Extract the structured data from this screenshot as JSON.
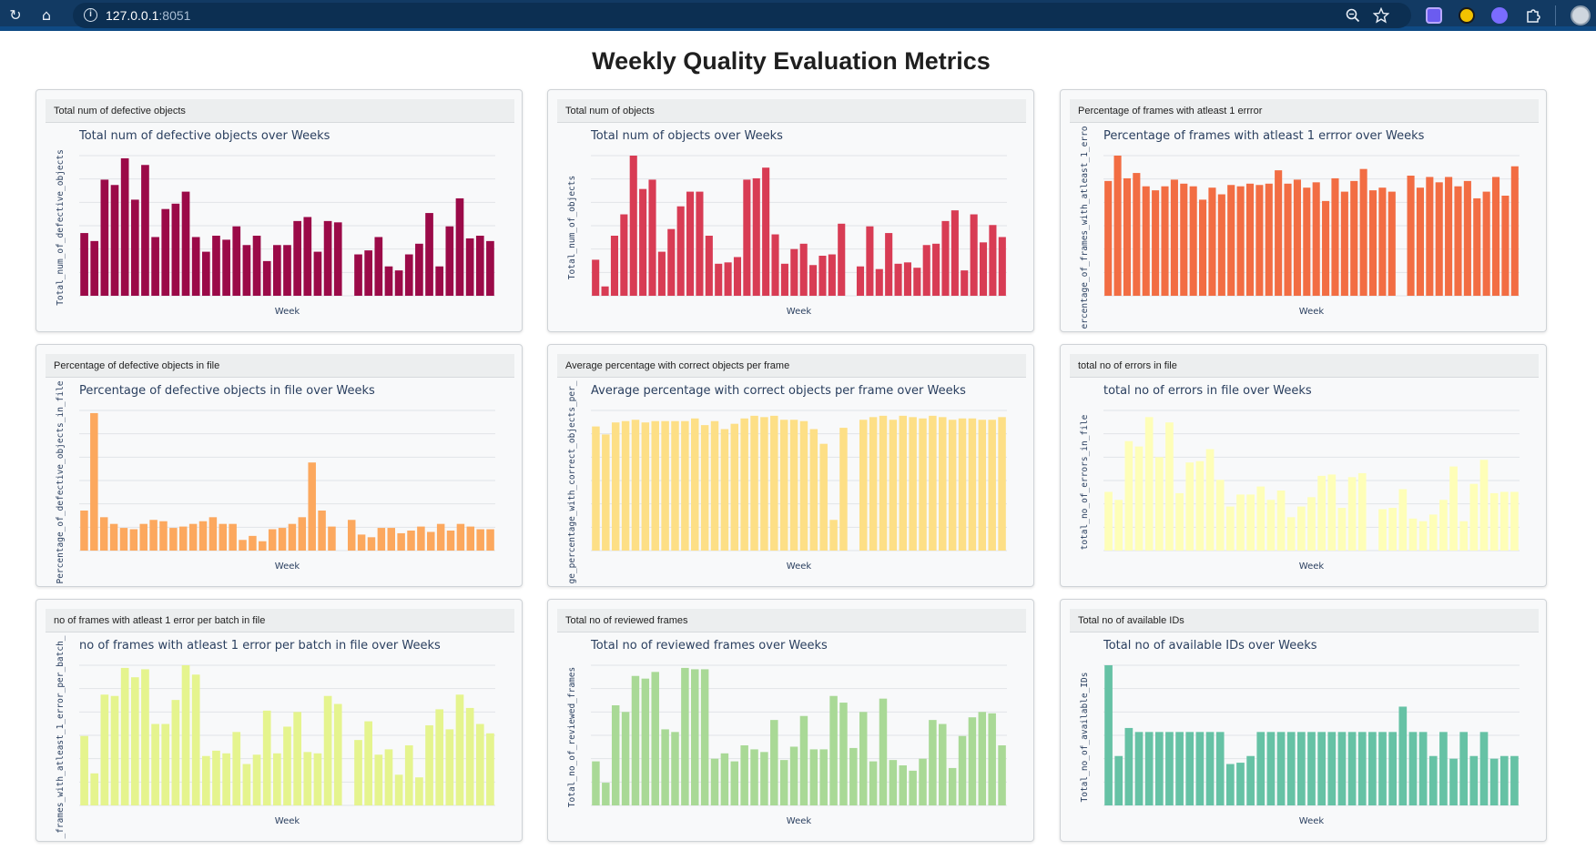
{
  "browser": {
    "url_host": "127.0.0.1",
    "url_port": ":8051",
    "icons": [
      "reload-icon",
      "home-icon",
      "site-info-icon",
      "zoom-icon",
      "bookmark-star-icon",
      "extension-camera-icon",
      "extension-smiley-icon",
      "extension-mask-icon",
      "extensions-puzzle-icon",
      "profile-avatar-icon"
    ]
  },
  "page": {
    "title": "Weekly Quality Evaluation Metrics"
  },
  "charts": [
    {
      "header": "Total num of defective objects",
      "chart_data": {
        "type": "bar",
        "title": "Total num of defective objects over Weeks",
        "xlabel": "Week",
        "ylabel": "Total_num_of_defective_objects",
        "color": "#9b0a48",
        "ylim": [
          0,
          105
        ],
        "grid": true,
        "values": [
          47,
          41,
          87,
          83,
          103,
          72,
          98,
          44,
          65,
          69,
          78,
          44,
          33,
          45,
          42,
          52,
          38,
          45,
          26,
          38,
          38,
          56,
          59,
          33,
          56,
          55,
          null,
          31,
          34,
          44,
          22,
          19,
          31,
          39,
          62,
          22,
          52,
          73,
          43,
          45,
          41
        ]
      }
    },
    {
      "header": "Total num of objects",
      "chart_data": {
        "type": "bar",
        "title": "Total num of objects over Weeks",
        "xlabel": "Week",
        "ylabel": "Total_num_of_objects",
        "color": "#d83c54",
        "ylim": [
          0,
          105
        ],
        "grid": true,
        "values": [
          27,
          7,
          45,
          61,
          105,
          80,
          87,
          33,
          50,
          67,
          78,
          78,
          45,
          24,
          25,
          29,
          87,
          88,
          96,
          46,
          24,
          35,
          39,
          23,
          30,
          31,
          54,
          null,
          22,
          52,
          20,
          47,
          24,
          25,
          21,
          38,
          39,
          56,
          64,
          19,
          61,
          40,
          53,
          44
        ]
      }
    },
    {
      "header": "Percentage of frames with atleast 1 errror",
      "chart_data": {
        "type": "bar",
        "title": "Percentage of frames with atleast 1 errror over Weeks",
        "xlabel": "Week",
        "ylabel": "ercentage_of_frames_with_atleast_1_erro",
        "color": "#f26d43",
        "ylim": [
          0,
          105
        ],
        "grid": true,
        "values": [
          86,
          105,
          88,
          92,
          82,
          79,
          82,
          87,
          84,
          82,
          72,
          81,
          76,
          83,
          82,
          84,
          83,
          84,
          94,
          84,
          87,
          81,
          85,
          71,
          88,
          78,
          86,
          95,
          79,
          81,
          78,
          null,
          90,
          81,
          89,
          85,
          89,
          82,
          86,
          73,
          78,
          89,
          75,
          97
        ]
      }
    },
    {
      "header": "Percentage of defective objects in file",
      "chart_data": {
        "type": "bar",
        "title": "Percentage of defective objects in file over Weeks",
        "xlabel": "Week",
        "ylabel": "Percentage_of_defective_objects_in_file",
        "color": "#fca85e",
        "ylim": [
          0,
          105
        ],
        "grid": true,
        "values": [
          30,
          103,
          25,
          20,
          17,
          16,
          20,
          23,
          22,
          17,
          18,
          20,
          22,
          25,
          20,
          20,
          8,
          11,
          7,
          16,
          17,
          20,
          25,
          66,
          30,
          18,
          null,
          23,
          12,
          10,
          17,
          17,
          13,
          15,
          18,
          14,
          20,
          15,
          20,
          18,
          16,
          16
        ]
      }
    },
    {
      "header": "Average percentage with correct objects per frame",
      "chart_data": {
        "type": "bar",
        "title": "Average percentage with correct objects per frame over Weeks",
        "xlabel": "Week",
        "ylabel": "ge_percentage_with_correct_objects_per_",
        "color": "#fddf86",
        "ylim": [
          0,
          105
        ],
        "grid": true,
        "values": [
          93,
          87,
          96,
          97,
          98,
          96,
          97,
          97,
          97,
          97,
          99,
          94,
          97,
          91,
          95,
          99,
          101,
          100,
          101,
          98,
          98,
          97,
          91,
          80,
          23,
          92,
          null,
          98,
          100,
          101,
          98,
          101,
          100,
          99,
          101,
          100,
          98,
          99,
          99,
          98,
          98,
          100
        ]
      }
    },
    {
      "header": "total no of errors in file",
      "chart_data": {
        "type": "bar",
        "title": "total no of errors in file over Weeks",
        "xlabel": "Week",
        "ylabel": "total_no_of_errors_in_file",
        "color": "#fefeb8",
        "ylim": [
          0,
          105
        ],
        "grid": true,
        "values": [
          44,
          38,
          82,
          78,
          100,
          70,
          96,
          43,
          66,
          67,
          76,
          53,
          33,
          42,
          42,
          48,
          38,
          45,
          25,
          33,
          40,
          56,
          57,
          32,
          55,
          58,
          null,
          31,
          32,
          46,
          24,
          22,
          27,
          38,
          63,
          22,
          50,
          68,
          43,
          44,
          44
        ]
      }
    },
    {
      "header": "no of frames with atleast 1 error per batch in file",
      "chart_data": {
        "type": "bar",
        "title": "no of frames with atleast 1 error per batch in file over Weeks",
        "xlabel": "Week",
        "ylabel": "_frames_with_atleast_1_error_per_batch_",
        "color": "#e5f48e",
        "ylim": [
          0,
          105
        ],
        "grid": true,
        "values": [
          52,
          24,
          83,
          82,
          103,
          96,
          102,
          61,
          61,
          79,
          105,
          98,
          37,
          41,
          39,
          55,
          31,
          38,
          71,
          39,
          59,
          70,
          40,
          39,
          82,
          76,
          null,
          49,
          63,
          38,
          42,
          23,
          45,
          21,
          60,
          72,
          57,
          83,
          73,
          61,
          54
        ]
      }
    },
    {
      "header": "Total no of reviewed frames",
      "chart_data": {
        "type": "bar",
        "title": "Total no of reviewed frames over Weeks",
        "xlabel": "Week",
        "ylabel": "Total_no_of_reviewed_frames",
        "color": "#a9d996",
        "ylim": [
          0,
          105
        ],
        "grid": true,
        "values": [
          33,
          17,
          75,
          70,
          97,
          95,
          100,
          57,
          55,
          103,
          102,
          102,
          35,
          39,
          33,
          45,
          42,
          40,
          64,
          34,
          44,
          67,
          42,
          42,
          82,
          77,
          43,
          70,
          33,
          80,
          34,
          30,
          26,
          35,
          64,
          61,
          28,
          52,
          66,
          70,
          69,
          45
        ]
      }
    },
    {
      "header": "Total no of available IDs",
      "chart_data": {
        "type": "bar",
        "title": "Total no of available IDs over Weeks",
        "xlabel": "Week",
        "ylabel": "Total_no_of_available_IDs",
        "color": "#66c2a5",
        "ylim": [
          0,
          105
        ],
        "grid": true,
        "values": [
          105,
          37,
          58,
          55,
          55,
          55,
          55,
          55,
          55,
          55,
          55,
          55,
          31,
          32,
          37,
          55,
          55,
          55,
          55,
          55,
          55,
          55,
          55,
          55,
          55,
          55,
          55,
          55,
          55,
          74,
          55,
          55,
          37,
          55,
          35,
          55,
          37,
          55,
          35,
          37,
          37
        ]
      }
    }
  ]
}
